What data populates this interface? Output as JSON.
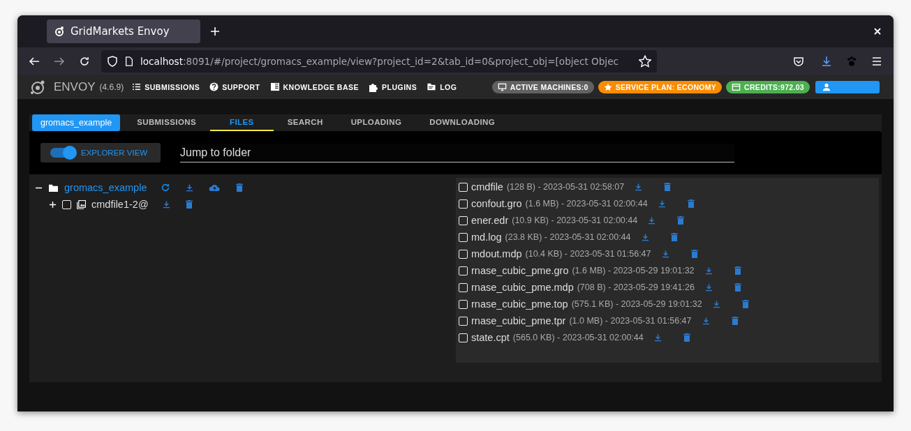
{
  "browser": {
    "tab_title": "GridMarkets Envoy",
    "url_host": "localhost",
    "url_rest": ":8091/#/project/gromacs_example/view?project_id=2&tab_id=0&project_obj=[object Objec"
  },
  "app_bar": {
    "brand": "ENVOY",
    "version": "(4.6.9)",
    "menu": [
      {
        "label": "SUBMISSIONS",
        "kind": "list"
      },
      {
        "label": "SUPPORT",
        "kind": "help"
      },
      {
        "label": "KNOWLEDGE BASE",
        "kind": "book"
      },
      {
        "label": "PLUGINS",
        "kind": "puzzle"
      },
      {
        "label": "LOG",
        "kind": "folder"
      }
    ],
    "badges": [
      {
        "label": "ACTIVE MACHINES:0",
        "kind": "monitor",
        "color": "#616161"
      },
      {
        "label": "SERVICE PLAN: ECONOMY",
        "kind": "star",
        "color": "#fb8c00"
      },
      {
        "label": "CREDITS:972.03",
        "kind": "card",
        "color": "#4caf50"
      }
    ]
  },
  "project_chip": "gromacs_example",
  "tabs": [
    {
      "label": "SUBMISSIONS",
      "selected": false
    },
    {
      "label": "FILES",
      "selected": true
    },
    {
      "label": "SEARCH",
      "selected": false
    },
    {
      "label": "UPLOADING",
      "selected": false
    },
    {
      "label": "DOWNLOADING",
      "selected": false
    }
  ],
  "explorer_toggle": {
    "label": "EXPLORER VIEW",
    "on": true
  },
  "jump_field": {
    "placeholder": "Jump to folder"
  },
  "tree": [
    {
      "name": "gromacs_example",
      "kind": "folder",
      "expanded": true,
      "children": [
        {
          "name": "cmdfile1-2@",
          "kind": "image",
          "expanded": false,
          "checked": false
        }
      ]
    }
  ],
  "files": [
    {
      "name": "cmdfile",
      "meta": "(128 B) - 2023-05-31 02:58:07",
      "checked": false
    },
    {
      "name": "confout.gro",
      "meta": "(1.6 MB) - 2023-05-31 02:00:44",
      "checked": false
    },
    {
      "name": "ener.edr",
      "meta": "(10.9 KB) - 2023-05-31 02:00:44",
      "checked": false
    },
    {
      "name": "md.log",
      "meta": "(23.8 KB) - 2023-05-31 02:00:44",
      "checked": false
    },
    {
      "name": "mdout.mdp",
      "meta": "(10.4 KB) - 2023-05-31 01:56:47",
      "checked": false
    },
    {
      "name": "rnase_cubic_pme.gro",
      "meta": "(1.6 MB) - 2023-05-29 19:01:32",
      "checked": false
    },
    {
      "name": "rnase_cubic_pme.mdp",
      "meta": "(708 B) - 2023-05-29 19:41:26",
      "checked": false
    },
    {
      "name": "rnase_cubic_pme.top",
      "meta": "(575.1 KB) - 2023-05-29 19:01:32",
      "checked": false
    },
    {
      "name": "rnase_cubic_pme.tpr",
      "meta": "(1.0 MB) - 2023-05-31 01:56:47",
      "checked": false
    },
    {
      "name": "state.cpt",
      "meta": "(565.0 KB) - 2023-05-31 02:00:44",
      "checked": false
    }
  ]
}
